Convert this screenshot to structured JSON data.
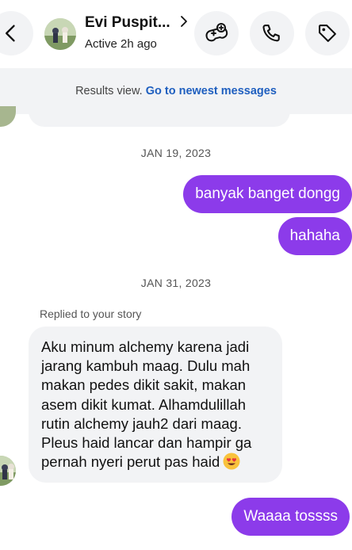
{
  "header": {
    "contact_name": "Evi Puspit...",
    "status": "Active 2h ago",
    "icons": {
      "back": "chevron-left-icon",
      "profile": "chevron-right-icon",
      "game": "game-controller-icon",
      "call": "phone-icon",
      "tag": "tag-icon"
    }
  },
  "banner": {
    "text": "Results view.",
    "link": "Go to newest messages"
  },
  "thread": {
    "date1": "JAN 19, 2023",
    "msg1": "banyak banget dongg",
    "msg2": "hahaha",
    "date2": "JAN 31, 2023",
    "reply_label": "Replied to your story",
    "incoming": "Aku minum alchemy karena jadi jarang kambuh maag. Dulu mah makan pedes dikit sakit, makan asem dikit kumat. Alhamdulillah rutin alchemy jauh2 dari maag. Pleus haid lancar dan hampir ga pernah  nyeri perut pas haid",
    "msg3": "Waaaa tossss"
  },
  "colors": {
    "outgoing_bubble": "#8c3bea",
    "incoming_bubble": "#f2f3f5",
    "link": "#1f5fbf"
  }
}
